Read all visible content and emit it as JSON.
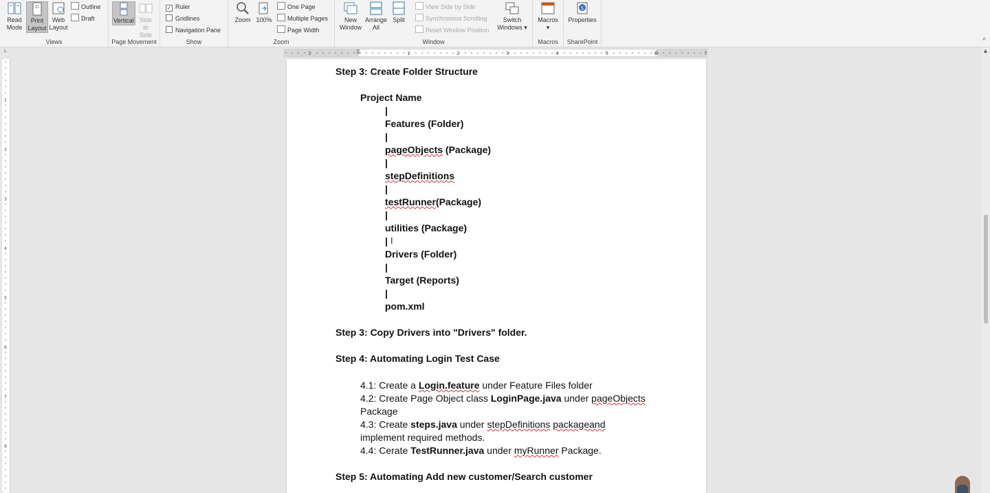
{
  "ribbon": {
    "views": {
      "label": "Views",
      "read_mode": "Read\nMode",
      "print_layout": "Print\nLayout",
      "web_layout": "Web\nLayout",
      "outline": "Outline",
      "draft": "Draft"
    },
    "page_movement": {
      "label": "Page Movement",
      "vertical": "Vertical",
      "side_to_side": "Side\nto Side"
    },
    "show": {
      "label": "Show",
      "ruler": "Ruler",
      "ruler_checked": true,
      "gridlines": "Gridlines",
      "navigation_pane": "Navigation Pane"
    },
    "zoom": {
      "label": "Zoom",
      "zoom": "Zoom",
      "hundred": "100%",
      "one_page": "One Page",
      "multiple_pages": "Multiple Pages",
      "page_width": "Page Width"
    },
    "window": {
      "label": "Window",
      "new_window": "New\nWindow",
      "arrange_all": "Arrange\nAll",
      "split": "Split",
      "view_side_by_side": "View Side by Side",
      "synchronous_scrolling": "Synchronous Scrolling",
      "reset_window_position": "Reset Window Position",
      "switch_windows": "Switch\nWindows ▾"
    },
    "macros": {
      "label": "Macros",
      "macros": "Macros\n▾"
    },
    "sharepoint": {
      "label": "SharePoint",
      "properties": "Properties"
    }
  },
  "ruler": {
    "numbers": [
      "1",
      "1",
      "2",
      "3",
      "4",
      "5",
      "6",
      "7"
    ],
    "vnumbers": [
      "1",
      "2",
      "3",
      "4",
      "5",
      "6",
      "7",
      "8"
    ]
  },
  "document": {
    "step3_heading": "Step 3: Create Folder Structure",
    "project_name": "Project Name",
    "pipe": "|",
    "features": "Features (Folder)",
    "page_objects_word": "pageObjects",
    "page_objects_rest": " (Package)",
    "step_definitions": "stepDefinitions",
    "test_runner_word": "testRunner",
    "test_runner_rest": "(Package)",
    "utilities": "utilities (Package)",
    "drivers": "Drivers (Folder)",
    "target": "Target (Reports)",
    "pom": "pom.xml",
    "step3_copy": "Step 3: Copy Drivers into \"Drivers\" folder.",
    "step4_heading": "Step 4: Automating Login Test Case",
    "s41_pre": "4.1: Create a ",
    "s41_bold": "Login.feature",
    "s41_post": " under Feature Files folder",
    "s42_pre": "4.2:  Create Page Object class ",
    "s42_bold": "LoginPage.java",
    "s42_mid": " under ",
    "s42_sq": "pageObjects",
    "s42_cont": "Package",
    "s43_pre": "4.3:  Create ",
    "s43_bold": "steps.java",
    "s43_mid": " under ",
    "s43_sq1": "stepDefinitions",
    "s43_sp": " ",
    "s43_sq2": "packageand",
    "s43_cont": "implement required methods.",
    "s44_pre": "4.4:  Cerate ",
    "s44_bold": "TestRunner.java",
    "s44_mid": " under ",
    "s44_sq": "myRunner",
    "s44_post": " Package.",
    "step5_heading": "Step 5: Automating Add new customer/Search customer"
  }
}
